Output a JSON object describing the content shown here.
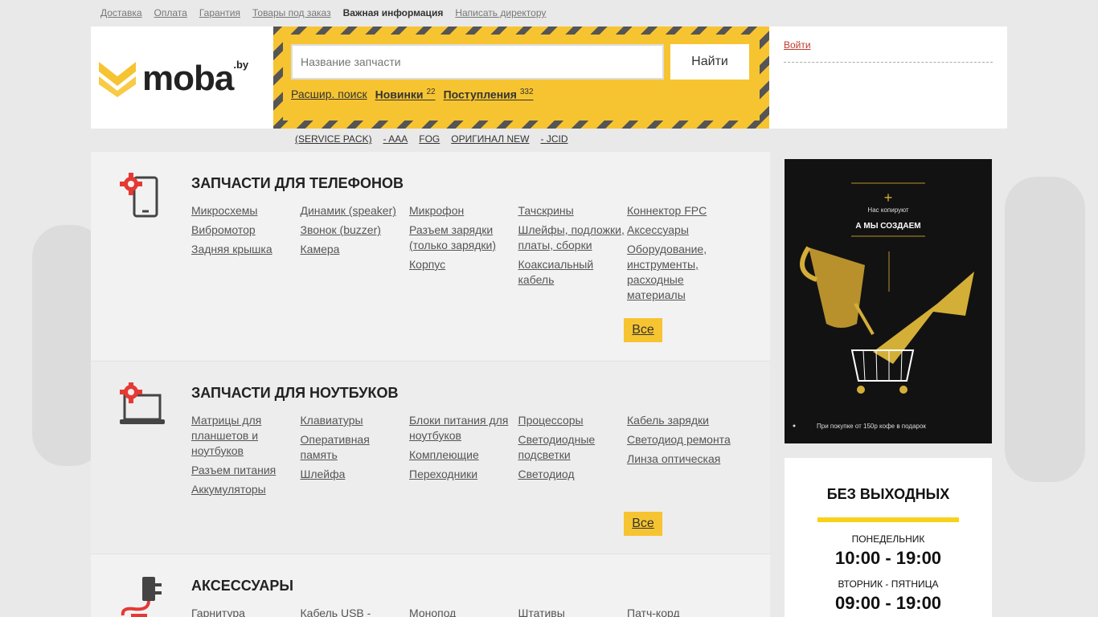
{
  "topnav": [
    "Доставка",
    "Оплата",
    "Гарантия",
    "Товары под заказ",
    "Важная информация",
    "Написать директору"
  ],
  "logo": {
    "text": "moba",
    "sup": ".by"
  },
  "search": {
    "placeholder": "Название запчасти",
    "button": "Найти",
    "links": [
      {
        "label": "Расшир. поиск",
        "count": ""
      },
      {
        "label": "Новинки",
        "count": "22"
      },
      {
        "label": "Поступления",
        "count": "332"
      }
    ]
  },
  "login": "Войти",
  "brands": [
    "(SERVICE PACK)",
    "- AAA",
    "FOG",
    "ОРИГИНАЛ NEW",
    "- JCID"
  ],
  "sections": [
    {
      "title": "ЗАПЧАСТИ ДЛЯ ТЕЛЕФОНОВ",
      "cols": [
        [
          "Микросхемы",
          "Вибромотор",
          "Задняя крышка"
        ],
        [
          "Динамик (speaker)",
          "Звонок (buzzer)",
          "Камера"
        ],
        [
          "Микрофон",
          "Разъем зарядки (только зарядки)",
          "Корпус"
        ],
        [
          "Тачскрины",
          "Шлейфы, подложки, платы, сборки",
          "Коаксиальный кабель"
        ],
        [
          "Коннектор FPC",
          "Аксессуары",
          "Оборудование, инструменты, расходные материалы"
        ]
      ],
      "all": "Все"
    },
    {
      "title": "ЗАПЧАСТИ ДЛЯ НОУТБУКОВ",
      "cols": [
        [
          "Матрицы для планшетов и ноутбуков",
          "Разъем питания",
          "Аккумуляторы"
        ],
        [
          "Клавиатуры",
          "Оперативная память",
          "Шлейфа"
        ],
        [
          "Блоки питания для ноутбуков",
          "Комплеющие",
          "Переходники"
        ],
        [
          "Процессоры",
          "Светодиодные подсветки",
          "Светодиод"
        ],
        [
          "Кабель зарядки",
          "Светодиод ремонта",
          "Линза оптическая"
        ]
      ],
      "all": "Все"
    },
    {
      "title": "АКСЕССУАРЫ",
      "cols": [
        [
          "Гарнитура"
        ],
        [
          "Кабель USB -"
        ],
        [
          "Монопод"
        ],
        [
          "Штативы"
        ],
        [
          "Патч-корд"
        ]
      ]
    }
  ],
  "banner": {
    "small": "Нас копируют",
    "big": "А МЫ СОЗДАЕМ",
    "foot": "При покупке от 150р кофе в подарок"
  },
  "hours": {
    "title": "БЕЗ ВЫХОДНЫХ",
    "rows": [
      {
        "day": "ПОНЕДЕЛЬНИК",
        "time": "10:00 - 19:00"
      },
      {
        "day": "ВТОРНИК - ПЯТНИЦА",
        "time": "09:00 - 19:00"
      }
    ]
  }
}
